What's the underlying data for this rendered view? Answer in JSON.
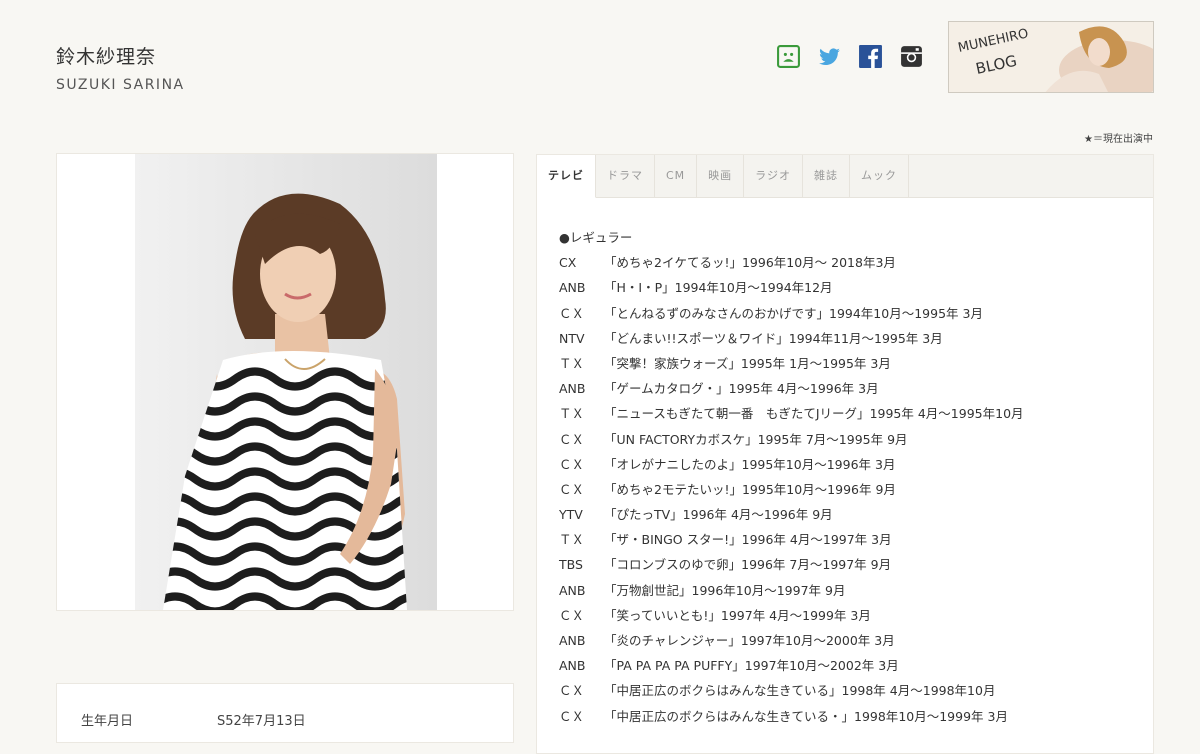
{
  "header": {
    "name": "鈴木紗理奈",
    "romaji": "SUZUKI SARINA"
  },
  "social": [
    {
      "icon": "ameblo-icon",
      "color": "#3a9a3a"
    },
    {
      "icon": "twitter-icon",
      "color": "#4aa6e0"
    },
    {
      "icon": "facebook-icon",
      "color": "#2a5298"
    },
    {
      "icon": "instagram-icon",
      "color": "#333333"
    }
  ],
  "blog_banner": {
    "logo_text": "MUNEHIRO BLOG"
  },
  "legend": "★＝現在出演中",
  "tabs": [
    "テレビ",
    "ドラマ",
    "CM",
    "映画",
    "ラジオ",
    "雑誌",
    "ムック"
  ],
  "active_tab": 0,
  "profile": {
    "birth_label": "生年月日",
    "birth_value": "S52年7月13日"
  },
  "tv_list": {
    "heading": "●レギュラー",
    "rows": [
      {
        "channel": "CX",
        "title": "「めちゃ2イケてるッ!」1996年10月～ 2018年3月"
      },
      {
        "channel": "ANB",
        "title": "「H・I・P」1994年10月～1994年12月"
      },
      {
        "channel": "ＣＸ",
        "title": "「とんねるずのみなさんのおかげです」1994年10月～1995年 3月"
      },
      {
        "channel": "NTV",
        "title": "「どんまい!!スポーツ＆ワイド」1994年11月～1995年 3月"
      },
      {
        "channel": "ＴＸ",
        "title": "「突撃！家族ウォーズ」1995年 1月～1995年 3月"
      },
      {
        "channel": "ANB",
        "title": "「ゲームカタログ・」1995年 4月～1996年 3月"
      },
      {
        "channel": "ＴＸ",
        "title": "「ニュースもぎたて朝一番　もぎたてJリーグ」1995年 4月～1995年10月"
      },
      {
        "channel": "ＣＸ",
        "title": "「UN FACTORYカボスケ」1995年 7月～1995年 9月"
      },
      {
        "channel": "ＣＸ",
        "title": "「オレがナニしたのよ」1995年10月～1996年 3月"
      },
      {
        "channel": "ＣＸ",
        "title": "「めちゃ2モテたいッ!」1995年10月～1996年 9月"
      },
      {
        "channel": "YTV",
        "title": "「ぴたっTV」1996年 4月～1996年 9月"
      },
      {
        "channel": "ＴＸ",
        "title": "「ザ・BINGO スター!」1996年 4月～1997年 3月"
      },
      {
        "channel": "TBS",
        "title": "「コロンブスのゆで卵」1996年 7月～1997年 9月"
      },
      {
        "channel": "ANB",
        "title": "「万物創世記」1996年10月～1997年 9月"
      },
      {
        "channel": "ＣＸ",
        "title": "「笑っていいとも!」1997年 4月～1999年 3月"
      },
      {
        "channel": "ANB",
        "title": "「炎のチャレンジャー」1997年10月～2000年 3月"
      },
      {
        "channel": "ANB",
        "title": "「PA PA PA PA PUFFY」1997年10月～2002年 3月"
      },
      {
        "channel": "ＣＸ",
        "title": "「中居正広のボクらはみんな生きている」1998年 4月～1998年10月"
      },
      {
        "channel": "ＣＸ",
        "title": "「中居正広のボクらはみんな生きている・」1998年10月～1999年 3月"
      }
    ]
  }
}
